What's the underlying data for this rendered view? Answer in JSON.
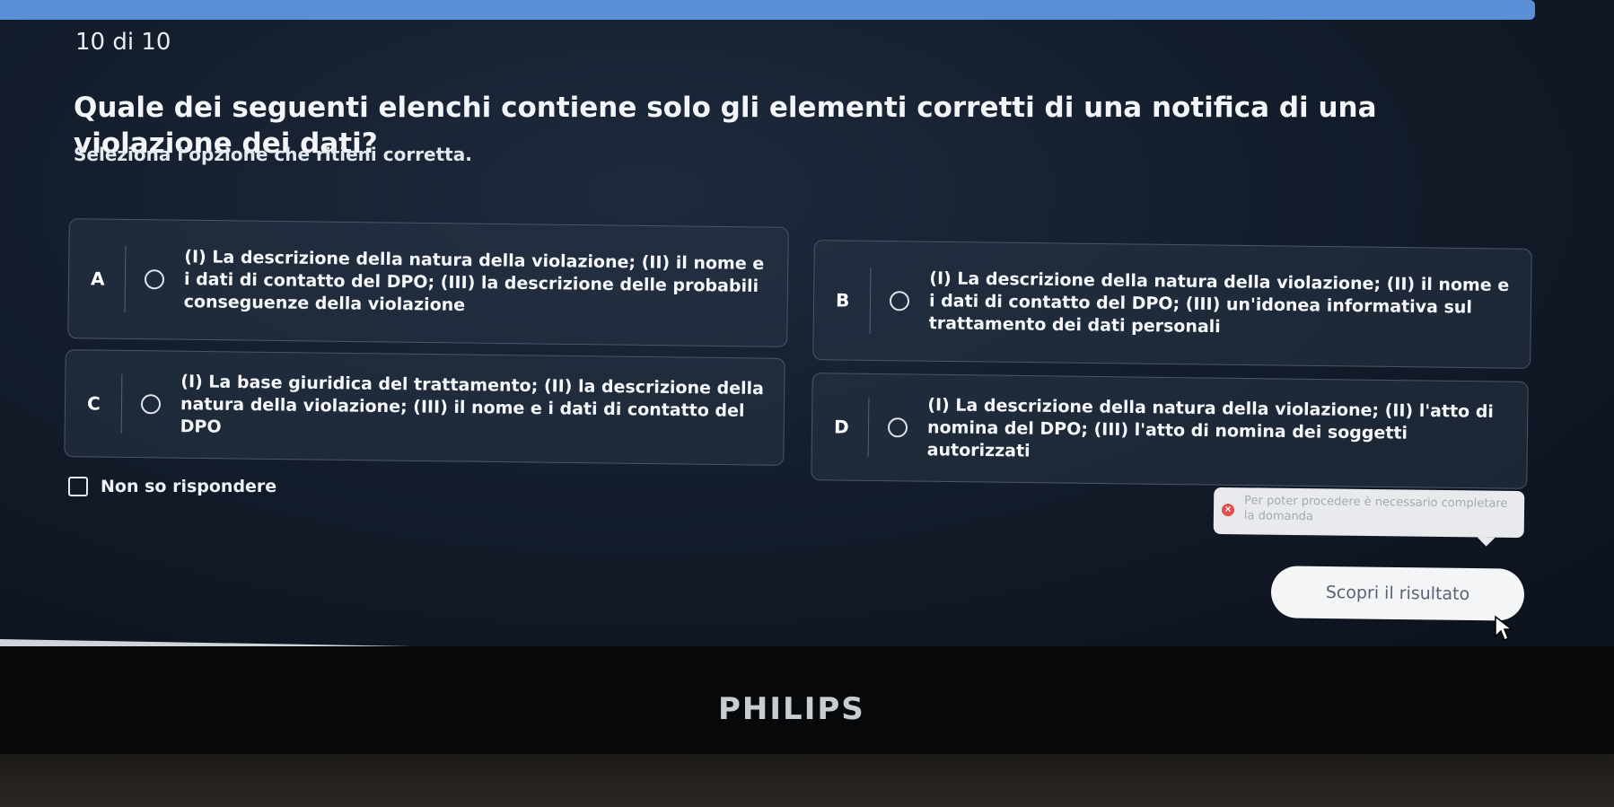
{
  "progress": {
    "current": 10,
    "total": 10,
    "fill": 1.0
  },
  "counter_text": "10 di 10",
  "question": "Quale dei seguenti elenchi contiene solo gli elementi corretti di una notifica di una violazione dei dati?",
  "instruction": "Seleziona l'opzione che ritieni corretta.",
  "options": [
    {
      "letter": "A",
      "text": "(I) La descrizione della natura della violazione; (II) il nome e i dati di contatto del DPO; (III) la descrizione delle probabili conseguenze della violazione"
    },
    {
      "letter": "B",
      "text": "(I) La descrizione della natura della violazione; (II) il nome e i dati di contatto del DPO; (III) un'idonea informativa sul trattamento dei dati personali"
    },
    {
      "letter": "C",
      "text": "(I) La base giuridica del trattamento; (II) la descrizione della natura della violazione; (III) il nome e i dati di contatto del DPO"
    },
    {
      "letter": "D",
      "text": "(I) La descrizione della natura della violazione; (II) l'atto di nomina del DPO; (III) l'atto di nomina dei soggetti autorizzati"
    }
  ],
  "unknown_label": "Non so rispondere",
  "tooltip": {
    "message": "Per poter procedere è necessario completare la domanda"
  },
  "submit_label": "Scopri il risultato",
  "monitor_brand": "PHILIPS",
  "colors": {
    "accent": "#3b6fb6",
    "error": "#e0504f",
    "background": "#141d2c"
  }
}
